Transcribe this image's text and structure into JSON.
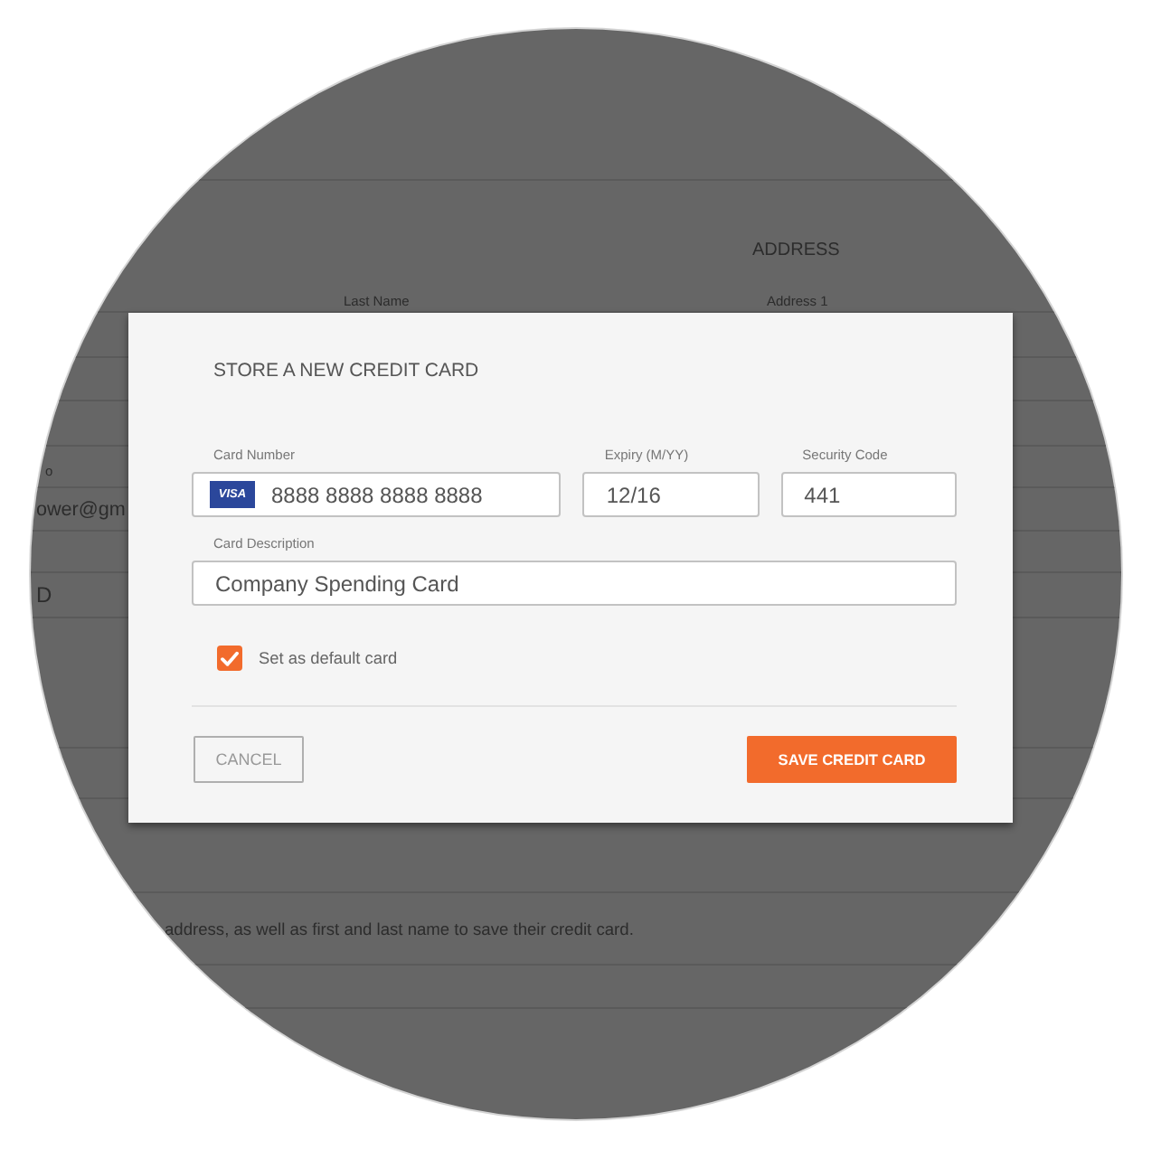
{
  "background_page": {
    "section_title": "ADDRESS",
    "column_labels": [
      "Last Name",
      "Address 1"
    ],
    "label_fragment": "o",
    "value_fragment": "ower@gm",
    "row_fragment": "D",
    "note": "address, as well as first and last name to save their credit card."
  },
  "dialog": {
    "title": "STORE A NEW CREDIT CARD",
    "field_rows": [
      {
        "fields": [
          {
            "kind": "card_number",
            "label": "Card Number",
            "card_badge": "VISA",
            "value": "8888 8888 8888 8888"
          },
          {
            "kind": "text",
            "label": "Expiry (M/YY)",
            "value": "12/16"
          },
          {
            "kind": "text",
            "label": "Security Code",
            "value": "441"
          }
        ]
      },
      {
        "fields": [
          {
            "kind": "text",
            "label": "Card Description",
            "value": "Company Spending Card"
          }
        ]
      }
    ],
    "default_card": {
      "label": "Set as default card",
      "checked": true
    },
    "buttons": [
      {
        "kind": "secondary",
        "label": "CANCEL"
      },
      {
        "kind": "primary",
        "label": "SAVE CREDIT CARD"
      }
    ]
  }
}
